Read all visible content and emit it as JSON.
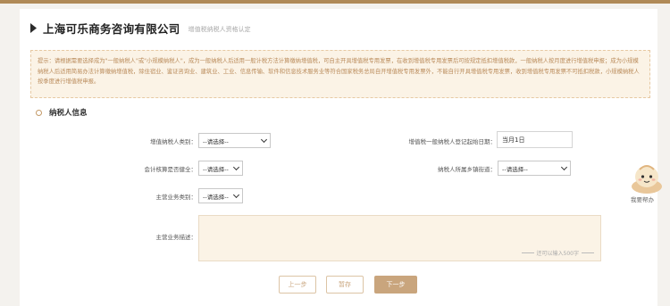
{
  "header": {
    "company": "上海可乐商务咨询有限公司",
    "subtitle": "增值税纳税人资格认定"
  },
  "tip": {
    "text": "提示：请根据需要选择成为\"一般纳税人\"或\"小规模纳税人\"，成为一般纳税人后适用一般计税方法计算缴纳增值税，可自主开具增值税专用发票，在收到增值税专用发票后可按规定抵扣增值税款，一般纳税人按月度进行增值税申报；成为小规模纳税人后适用简易办法计算缴纳增值税，除住宿业、鉴证咨询业、建筑业、工业、信息传输、软件和信息技术服务业等符合国家税务总局自开增值税专用发票外，不能自行开具增值税专用发票，收到增值税专用发票不可抵扣税款，小规模纳税人按季度进行增值税申报。"
  },
  "section": {
    "title": "纳税人信息"
  },
  "form": {
    "taxpayer_type": {
      "label": "增值纳税人类别：",
      "value": "--请选择--"
    },
    "start_date": {
      "label": "增值税一般纳税人登记起始日期：",
      "value": "当月1日"
    },
    "accounting": {
      "label": "会计核算是否健全：",
      "value": "--请选择--"
    },
    "town": {
      "label": "纳税人所属乡镇街道：",
      "value": "--请选择--"
    },
    "business_type": {
      "label": "主营业务类别：",
      "value": "--请选择--"
    },
    "business_desc": {
      "label": "主营业务描述：",
      "counter": "还可以输入500字"
    }
  },
  "buttons": {
    "prev": "上一步",
    "save": "暂存",
    "next": "下一步"
  },
  "helper": {
    "label": "我要帮办"
  }
}
